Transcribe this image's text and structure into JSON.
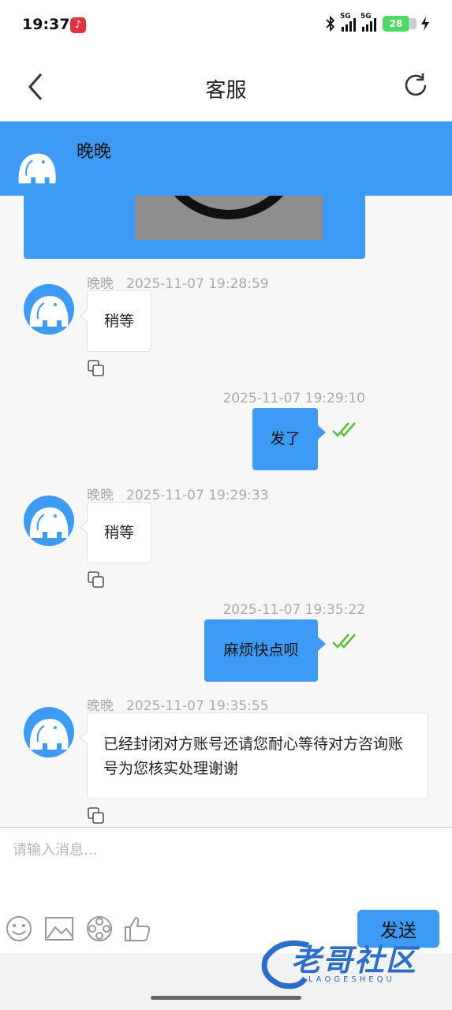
{
  "status_bar": {
    "time": "19:37",
    "network_1": "5G",
    "network_2": "5G",
    "battery": "28"
  },
  "nav": {
    "title": "客服"
  },
  "agent": {
    "name": "晚晚"
  },
  "messages": [
    {
      "from": "agent",
      "sender": "晚晚",
      "time": "2025-11-07 19:28:59",
      "text": "稍等"
    },
    {
      "from": "me",
      "time": "2025-11-07 19:29:10",
      "text": "发了"
    },
    {
      "from": "agent",
      "sender": "晚晚",
      "time": "2025-11-07 19:29:33",
      "text": "稍等"
    },
    {
      "from": "me",
      "time": "2025-11-07 19:35:22",
      "text": "麻烦快点呗"
    },
    {
      "from": "agent",
      "sender": "晚晚",
      "time": "2025-11-07 19:35:55",
      "text": "已经封闭对方账号还请您耐心等待对方咨询账号为您核实处理谢谢"
    }
  ],
  "input": {
    "placeholder": "请输入消息..."
  },
  "send_label": "发送",
  "toolbar_icons": [
    "emoji-icon",
    "image-icon",
    "video-icon",
    "thumbs-up-icon"
  ],
  "watermark": {
    "text": "老哥社区",
    "sub": "LAOGESHEQU"
  },
  "colors": {
    "accent": "#3d9bf5",
    "read_check": "#5cbf3a"
  }
}
